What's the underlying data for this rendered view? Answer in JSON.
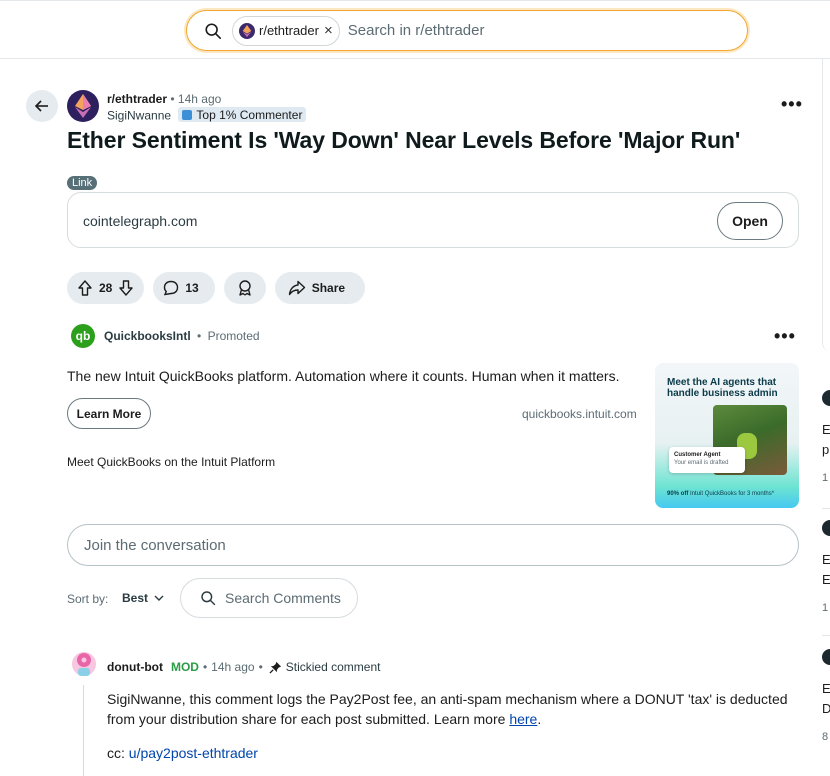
{
  "search": {
    "chip_label": "r/ethtrader",
    "chip_close": "×",
    "placeholder": "Search in r/ethtrader"
  },
  "post": {
    "subreddit": "r/ethtrader",
    "separator": "•",
    "time": "14h ago",
    "author": "SigiNwanne",
    "author_badge": "Top 1% Commenter",
    "more": "•••",
    "title": "Ether Sentiment Is 'Way Down' Near Levels Before 'Major Run'",
    "flair": "Link",
    "link_domain": "cointelegraph.com",
    "open_label": "Open",
    "upvotes": "28",
    "comments": "13",
    "share_label": "Share"
  },
  "ad": {
    "logo_text": "qb",
    "advertiser": "QuickbooksIntl",
    "separator": "•",
    "promoted": "Promoted",
    "more": "•••",
    "text": "The new Intuit QuickBooks platform. Automation where it counts. Human when it matters.",
    "cta": "Learn More",
    "domain": "quickbooks.intuit.com",
    "caption": "Meet QuickBooks on the Intuit Platform",
    "image_headline": "Meet the AI agents that handle business admin",
    "image_card_title": "Customer Agent",
    "image_card_text": "Your email is drafted",
    "image_offer_bold": "90% off",
    "image_offer_rest": "Intuit QuickBooks for 3 months*"
  },
  "comments_section": {
    "join_placeholder": "Join the conversation",
    "sort_label": "Sort by:",
    "sort_value": "Best",
    "search_comments": "Search Comments"
  },
  "comment": {
    "author": "donut-bot",
    "role": "MOD",
    "separator": "•",
    "time": "14h ago",
    "separator2": "•",
    "stickied": "Stickied comment",
    "body_before_link": "SigiNwanne, this comment logs the Pay2Post fee, an anti-spam mechanism where a DONUT 'tax' is deducted from your distribution share for each post submitted. Learn more ",
    "body_link": "here",
    "body_after_link": ".",
    "cc_label": "cc: ",
    "cc_link": "u/pay2post-ethtrader"
  },
  "rail": [
    {
      "text1": "E",
      "text2": "p",
      "num": "1"
    },
    {
      "text1": "E",
      "text2": "E",
      "num": "1"
    },
    {
      "text1": "E",
      "text2": "D",
      "num": "8"
    }
  ],
  "colors": {
    "search_focus": "#f0a830",
    "pill_bg": "#e5ebee",
    "link": "#0045ac",
    "mod_green": "#2a9c45",
    "quickbooks_green": "#2ca01c",
    "flair_bg": "#576f76"
  },
  "icons": [
    "search-icon",
    "close-icon",
    "back-arrow-icon",
    "ethereum-icon",
    "upvote-icon",
    "downvote-icon",
    "comment-icon",
    "award-icon",
    "share-icon",
    "chevron-down-icon",
    "pin-icon",
    "donut-avatar-icon"
  ]
}
